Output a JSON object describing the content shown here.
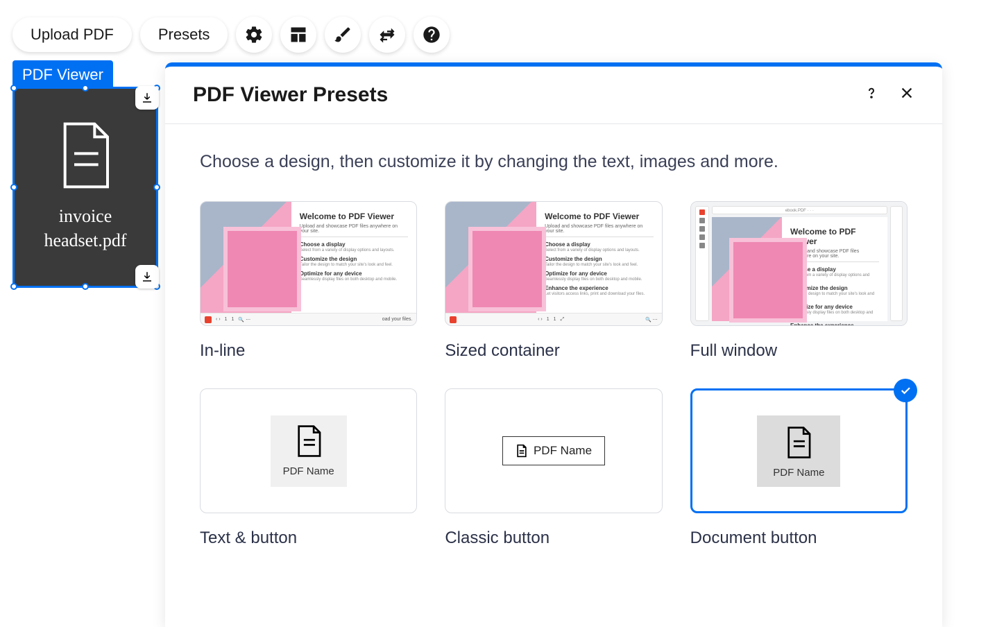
{
  "toolbar": {
    "upload_label": "Upload PDF",
    "presets_label": "Presets"
  },
  "widget": {
    "label": "PDF Viewer",
    "filename": "invoice headset.pdf"
  },
  "panel": {
    "title": "PDF Viewer Presets",
    "description": "Choose a design, then customize it by changing the text, images and more."
  },
  "presets": {
    "in_line": "In-line",
    "sized_container": "Sized container",
    "full_window": "Full window",
    "text_button": "Text & button",
    "classic_button": "Classic button",
    "document_button": "Document button"
  },
  "mock": {
    "welcome_title": "Welcome to PDF Viewer",
    "welcome_sub": "Upload and showcase PDF files anywhere on your site.",
    "sec1_h": "Choose a display",
    "sec1_t": "Select from a variety of display options and layouts.",
    "sec2_h": "Customize the design",
    "sec2_t": "Tailor the design to match your site's look and feel.",
    "sec3_h": "Optimize for any device",
    "sec3_t": "Seamlessly display files on both desktop and mobile.",
    "sec4_h": "Enhance the experience",
    "sec4_t": "Let visitors access links, print and download your files.",
    "page_num": "1",
    "pdf_name": "PDF Name"
  }
}
